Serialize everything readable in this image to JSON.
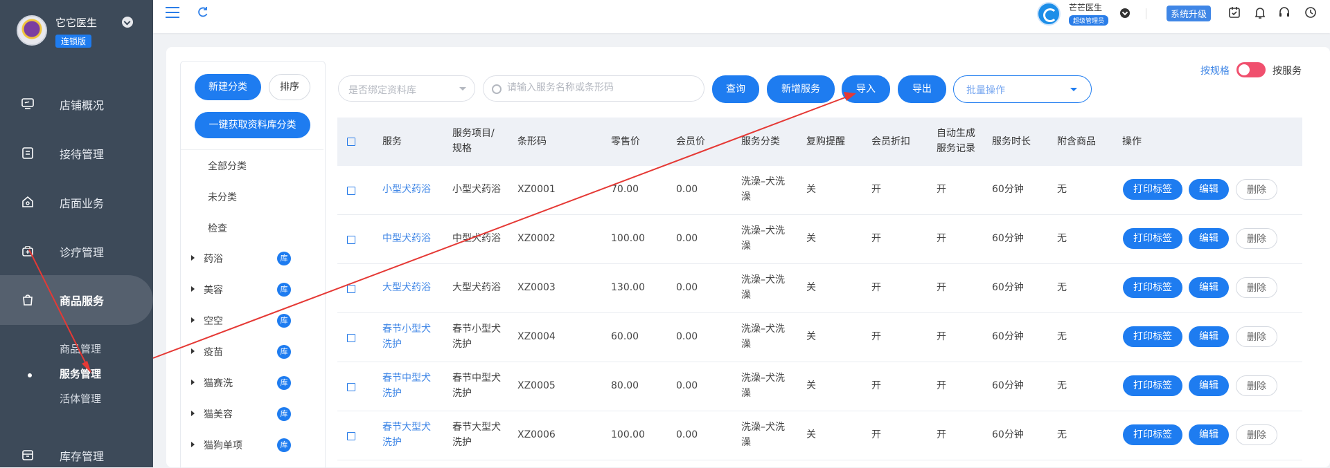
{
  "sidebar": {
    "clinic_name": "它它医生",
    "edition_badge": "连锁版",
    "menu": [
      {
        "label": "店铺概况",
        "icon": "monitor-icon"
      },
      {
        "label": "接待管理",
        "icon": "clipboard-icon"
      },
      {
        "label": "店面业务",
        "icon": "home-icon"
      },
      {
        "label": "诊疗管理",
        "icon": "medical-kit-icon"
      },
      {
        "label": "商品服务",
        "icon": "bag-icon"
      },
      {
        "label": "库存管理",
        "icon": "box-icon"
      }
    ],
    "submenu": [
      "商品管理",
      "服务管理",
      "活体管理"
    ]
  },
  "topbar": {
    "user_name": "芒芒医生",
    "user_role": "超级管理员",
    "upgrade_label": "系统升级"
  },
  "category": {
    "new_label": "新建分类",
    "sort_label": "排序",
    "fetch_label": "一键获取资料库分类",
    "flat_items": [
      "全部分类",
      "未分类",
      "检查"
    ],
    "tree_items": [
      "药浴",
      "美容",
      "空空",
      "疫苗",
      "猫赛洗",
      "猫美容",
      "猫狗单项"
    ],
    "lib_badge": "库"
  },
  "toolbar": {
    "bind_placeholder": "是否绑定资料库",
    "search_placeholder": "请输入服务名称或条形码",
    "query_label": "查询",
    "add_label": "新增服务",
    "import_label": "导入",
    "export_label": "导出",
    "batch_label": "批量操作",
    "toggle_left": "按规格",
    "toggle_right": "按服务"
  },
  "table": {
    "headers": {
      "service": "服务",
      "item_spec_1": "服务项目/",
      "item_spec_2": "规格",
      "barcode": "条形码",
      "retail": "零售价",
      "member": "会员价",
      "category": "服务分类",
      "repurchase": "复购提醒",
      "discount": "会员折扣",
      "auto_1": "自动生成",
      "auto_2": "服务记录",
      "duration": "服务时长",
      "attached": "附含商品",
      "actions": "操作"
    },
    "rows": [
      {
        "service_1": "小型犬药浴",
        "service_2": "",
        "item_1": "小型犬药浴",
        "item_2": "",
        "barcode": "XZ0001",
        "retail": "70.00",
        "member": "0.00",
        "cat_1": "洗澡–犬洗",
        "cat_2": "澡",
        "repurchase": "关",
        "discount": "开",
        "auto": "开",
        "duration": "60分钟",
        "attached": "无"
      },
      {
        "service_1": "中型犬药浴",
        "service_2": "",
        "item_1": "中型犬药浴",
        "item_2": "",
        "barcode": "XZ0002",
        "retail": "100.00",
        "member": "0.00",
        "cat_1": "洗澡–犬洗",
        "cat_2": "澡",
        "repurchase": "关",
        "discount": "开",
        "auto": "开",
        "duration": "60分钟",
        "attached": "无"
      },
      {
        "service_1": "大型犬药浴",
        "service_2": "",
        "item_1": "大型犬药浴",
        "item_2": "",
        "barcode": "XZ0003",
        "retail": "130.00",
        "member": "0.00",
        "cat_1": "洗澡–犬洗",
        "cat_2": "澡",
        "repurchase": "关",
        "discount": "开",
        "auto": "开",
        "duration": "60分钟",
        "attached": "无"
      },
      {
        "service_1": "春节小型犬",
        "service_2": "洗护",
        "item_1": "春节小型犬",
        "item_2": "洗护",
        "barcode": "XZ0004",
        "retail": "60.00",
        "member": "0.00",
        "cat_1": "洗澡–犬洗",
        "cat_2": "澡",
        "repurchase": "关",
        "discount": "开",
        "auto": "开",
        "duration": "60分钟",
        "attached": "无"
      },
      {
        "service_1": "春节中型犬",
        "service_2": "洗护",
        "item_1": "春节中型犬",
        "item_2": "洗护",
        "barcode": "XZ0005",
        "retail": "80.00",
        "member": "0.00",
        "cat_1": "洗澡–犬洗",
        "cat_2": "澡",
        "repurchase": "关",
        "discount": "开",
        "auto": "开",
        "duration": "60分钟",
        "attached": "无"
      },
      {
        "service_1": "春节大型犬",
        "service_2": "洗护",
        "item_1": "春节大型犬",
        "item_2": "洗护",
        "barcode": "XZ0006",
        "retail": "100.00",
        "member": "0.00",
        "cat_1": "洗澡–犬洗",
        "cat_2": "澡",
        "repurchase": "关",
        "discount": "开",
        "auto": "开",
        "duration": "60分钟",
        "attached": "无"
      }
    ],
    "actions": {
      "print": "打印标签",
      "edit": "编辑",
      "delete": "删除"
    }
  },
  "colors": {
    "primary": "#1e7cf0",
    "sidebar": "#3d4a59",
    "annotation": "#e53935",
    "toggle": "#f0506e"
  }
}
